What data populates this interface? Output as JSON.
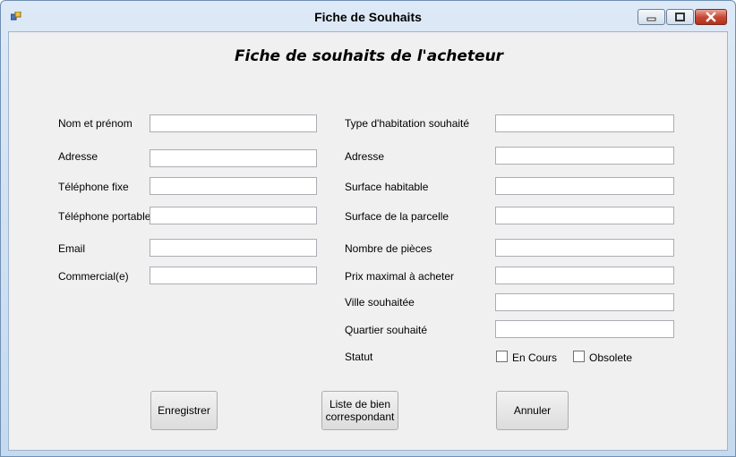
{
  "window": {
    "title": "Fiche de Souhaits"
  },
  "form": {
    "heading": "Fiche de souhaits de l'acheteur",
    "left_labels": [
      "Nom et prénom",
      "Adresse",
      "Téléphone fixe",
      "Téléphone portable",
      "Email",
      "Commercial(e)"
    ],
    "right_labels": [
      "Type d'habitation souhaité",
      "Adresse",
      "Surface habitable",
      "Surface de la parcelle",
      "Nombre de pièces",
      "Prix maximal à acheter",
      "Ville souhaitée",
      "Quartier souhaité"
    ],
    "statut_label": "Statut",
    "checkbox_en_cours": "En Cours",
    "checkbox_obsolete": "Obsolete"
  },
  "buttons": {
    "save": "Enregistrer",
    "list": "Liste de bien correspondant",
    "cancel": "Annuler"
  },
  "icons": [
    "app-icon",
    "minimize-icon",
    "maximize-icon",
    "close-icon"
  ]
}
